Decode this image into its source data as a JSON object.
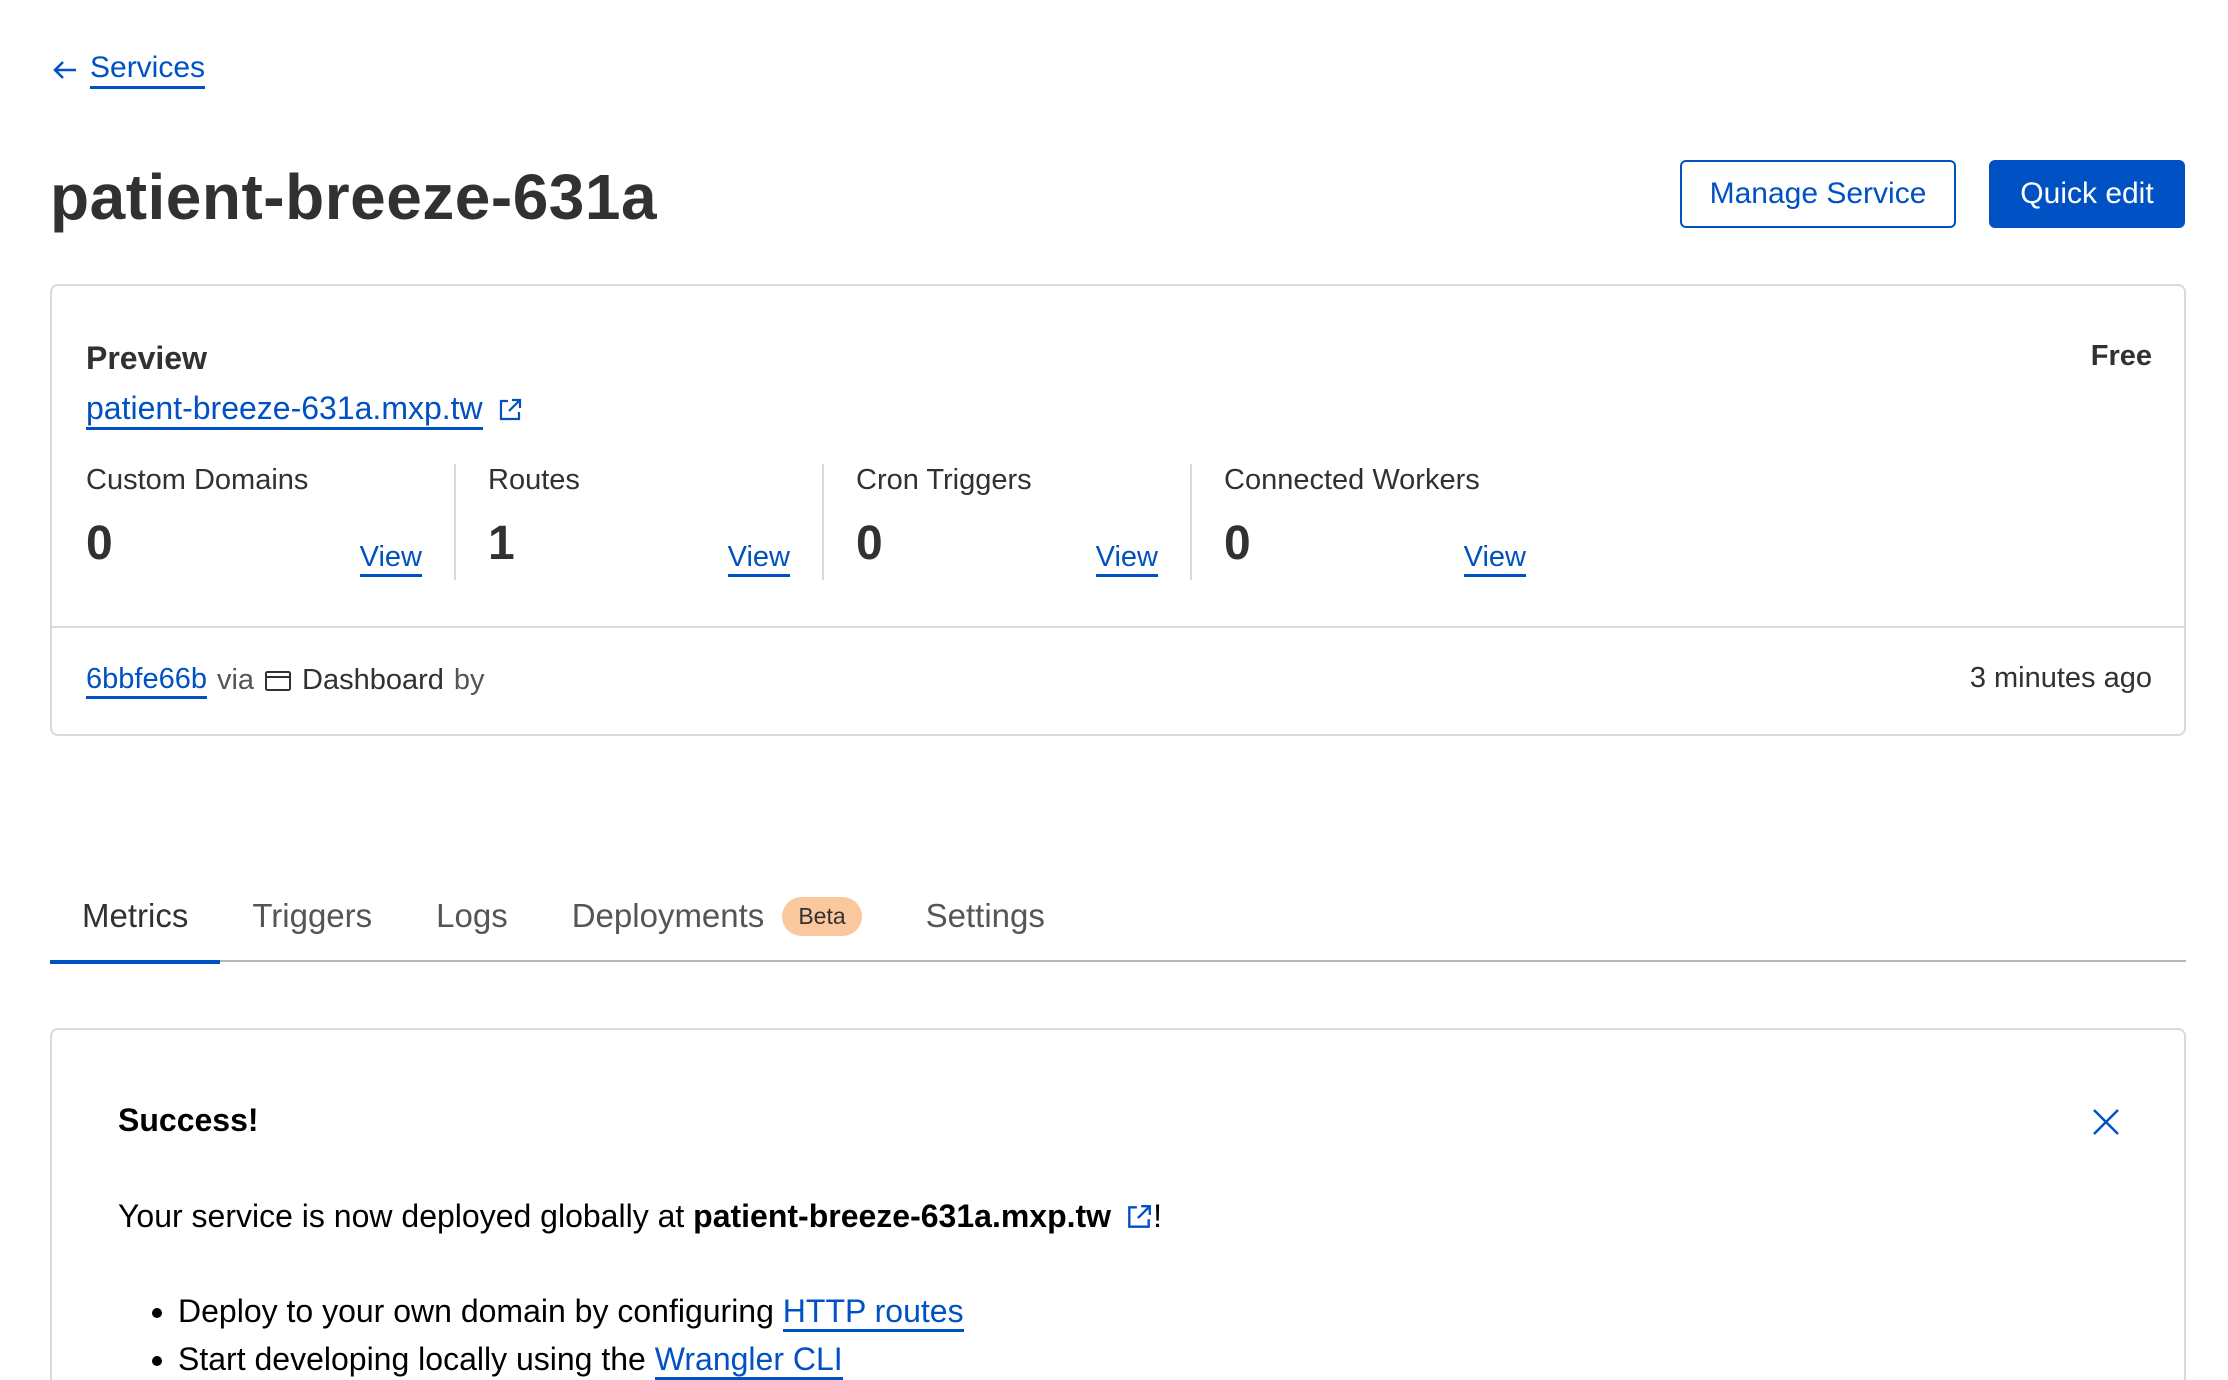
{
  "nav": {
    "back_label": "Services"
  },
  "header": {
    "title": "patient-breeze-631a",
    "manage_button": "Manage Service",
    "quick_edit_button": "Quick edit"
  },
  "overview": {
    "preview_heading": "Preview",
    "preview_url": "patient-breeze-631a.mxp.tw",
    "plan": "Free",
    "stats": [
      {
        "label": "Custom Domains",
        "value": "0",
        "action": "View"
      },
      {
        "label": "Routes",
        "value": "1",
        "action": "View"
      },
      {
        "label": "Cron Triggers",
        "value": "0",
        "action": "View"
      },
      {
        "label": "Connected Workers",
        "value": "0",
        "action": "View"
      }
    ],
    "deployment": {
      "commit": "6bbfe66b",
      "via": "via",
      "source": "Dashboard",
      "by": "by",
      "time": "3 minutes ago"
    }
  },
  "tabs": [
    {
      "label": "Metrics",
      "active": true
    },
    {
      "label": "Triggers"
    },
    {
      "label": "Logs"
    },
    {
      "label": "Deployments",
      "badge": "Beta"
    },
    {
      "label": "Settings"
    }
  ],
  "alert": {
    "title": "Success!",
    "message_prefix": "Your service is now deployed globally at ",
    "message_url": "patient-breeze-631a.mxp.tw",
    "message_suffix": "!",
    "items": [
      {
        "text": "Deploy to your own domain by configuring ",
        "link": "HTTP routes"
      },
      {
        "text": "Start developing locally using the ",
        "link": "Wrangler CLI"
      }
    ]
  },
  "colors": {
    "accent": "#0051c3",
    "badge": "#fbc89d",
    "border": "#d9d9d9"
  },
  "icons": [
    "arrow-left-icon",
    "external-link-icon",
    "dashboard-icon",
    "close-icon"
  ]
}
